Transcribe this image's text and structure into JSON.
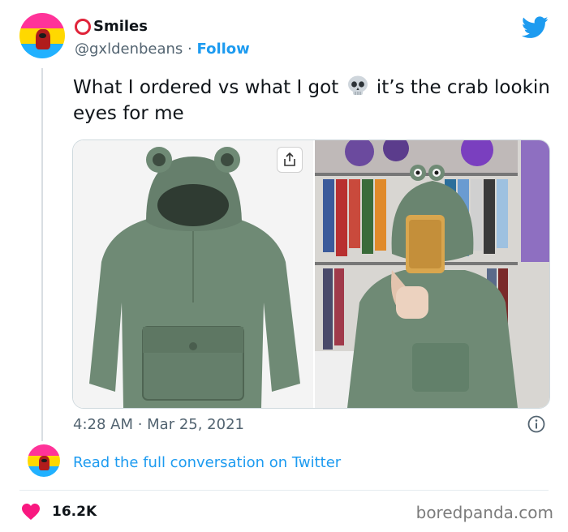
{
  "tweet": {
    "display_name": "Smiles",
    "handle": "@gxldenbeans",
    "separator": "·",
    "follow_label": "Follow",
    "text_before_emoji": "What I ordered vs what I got",
    "emoji": "skull-icon",
    "text_after_emoji": "it’s the crab lookin eyes for me",
    "timestamp": "4:28 AM · Mar 25, 2021",
    "read_conversation_label": "Read the full conversation on Twitter",
    "like_count": "16.2K"
  },
  "media": {
    "images": [
      {
        "name": "ordered-frog-hoodie-photo"
      },
      {
        "name": "received-frog-hoodie-mirror-selfie"
      }
    ]
  },
  "watermark": "boredpanda.com",
  "colors": {
    "twitter_blue": "#1d9bf0",
    "text_primary": "#0f1419",
    "text_secondary": "#536471",
    "like_red": "#f91880",
    "hoodie_green": "#6f8a75"
  },
  "icons": [
    "twitter-logo-icon",
    "skull-icon",
    "share-icon",
    "info-icon",
    "heart-icon"
  ]
}
